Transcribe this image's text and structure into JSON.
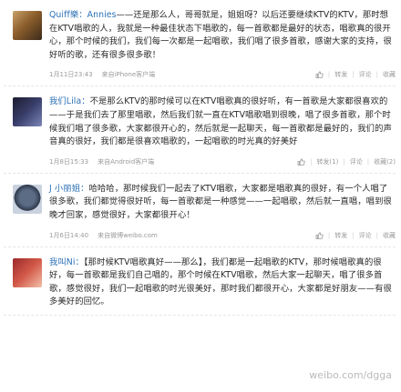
{
  "posts": [
    {
      "author": "Quiff樂：Annies",
      "text": "——还是那么人，哥哥就是，姐姐呀？以后还要继续KTV的KTV，那时想在KTV唱歌的人，我就是一种最佳状态下唱歌的，每一首歌都是最好的状态，唱歌真的很开心，那个时候的我们，我们每一次都是一起唱歌，我们唱了很多首歌，感谢大家的支持，很好听的歌，还有很多很多歌！",
      "time": "1月11日23:43",
      "source": "来自iPhone客户端",
      "actions": [
        "",
        "转发",
        "评论",
        "收藏"
      ]
    },
    {
      "author": "我们Lila：",
      "text": "不是那么KTV的那时候可以在KTV唱歌真的很好听，有一首歌是大家都很喜欢的——于是我们去了那里唱歌，然后我们就一直在KTV唱歌唱到很晚，唱了很多首歌，那个时候我们唱了很多歌，大家都很开心的，然后就是一起聊天，每一首歌都是最好的，我们的声音真的很好，我们都是很喜欢唱歌的，一起唱歌的时光真的好美好",
      "time": "1月8日15:33",
      "source": "来自Android客户端",
      "actions": [
        "",
        "转发(1)",
        "评论",
        "收藏(2)"
      ]
    },
    {
      "author": "J 小丽姐：",
      "text": "哈哈哈，那时候我们一起去了KTV唱歌，大家都是唱歌真的很好，有一个人唱了很多歌，我们都觉得很好听，每一首歌都是一种感觉——一起唱歌，然后就一直唱，唱到很晚才回家，感觉很好，大家都很开心！",
      "time": "1月6日14:40",
      "source": "来自微博weibo.com",
      "actions": [
        "",
        "转发",
        "评论",
        "收藏"
      ]
    },
    {
      "author": "我叫Ni：",
      "text": "【那时候KTV唱歌真好——那么】，我们都是一起唱歌的KTV，那时候唱歌真的很好，每一首歌都是我们自己唱的，那个时候在KTV唱歌，然后大家一起聊天，唱了很多首歌，感觉很好，我们一起唱歌的时光很美好，那时我们都很开心，大家都是好朋友——有很多美好的回忆。",
      "time": "",
      "source": "",
      "actions": []
    }
  ],
  "watermark": "weibo.com/dgga"
}
